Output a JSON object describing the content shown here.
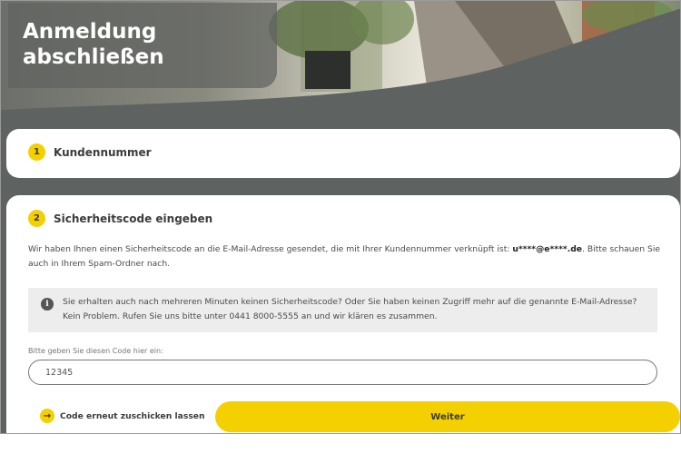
{
  "header": {
    "title": "Anmeldung abschließen"
  },
  "step1": {
    "number": "1",
    "label": "Kundennummer"
  },
  "step2": {
    "number": "2",
    "label": "Sicherheitscode eingeben",
    "description_before": "Wir haben Ihnen einen Sicherheitscode an die E-Mail-Adresse gesendet, die mit Ihrer Kundennummer verknüpft ist: ",
    "email": "u****@e****.de",
    "description_after": ". Bitte schauen Sie auch in Ihrem Spam-Ordner nach.",
    "info_icon": "info-icon",
    "info_text": "Sie erhalten auch nach mehreren Minuten keinen Sicherheitscode? Oder Sie haben keinen Zugriff mehr auf die genannte E-Mail-Adresse? Kein Problem. Rufen Sie uns bitte unter 0441 8000-5555 an und wir klären es zusammen.",
    "code_label": "Bitte geben Sie diesen Code hier ein:",
    "code_value": "12345",
    "resend_icon": "arrow-right-icon",
    "resend_label": "Code erneut zuschicken lassen",
    "submit_label": "Weiter"
  },
  "colors": {
    "accent": "#f4d000",
    "background": "#5e6361",
    "card": "#ffffff",
    "info_bg": "#ededed"
  }
}
